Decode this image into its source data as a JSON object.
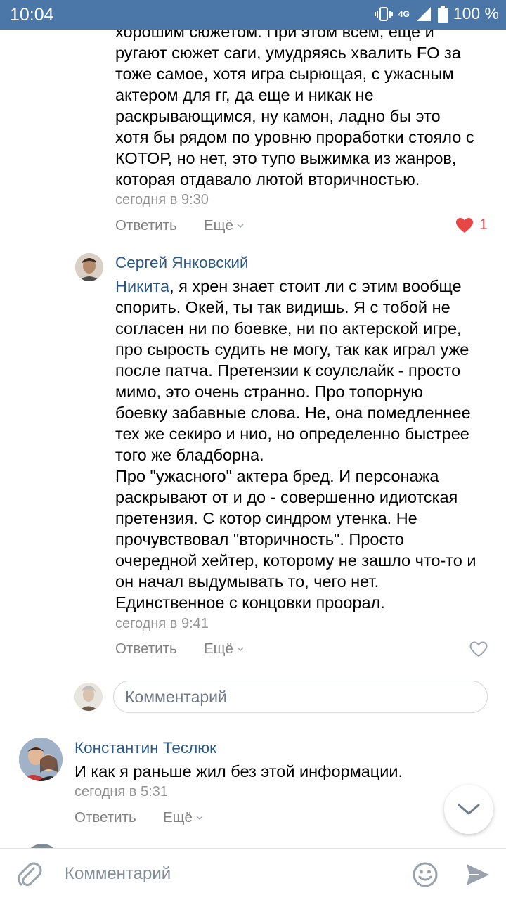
{
  "status_bar": {
    "time": "10:04",
    "network": "4G",
    "battery": "100 %"
  },
  "comment1": {
    "lines": [
      "хорошим сюжетом. При этом всем, еще и",
      "ругают сюжет саги, умудряясь хвалить FO за",
      "тоже самое, хотя игра сырющая, с ужасным",
      "актером для гг, да еще и никак не",
      "раскрывающимся, ну камон, ладно бы это",
      "хотя бы рядом по уровню проработки стояло с",
      "КОТОР, но нет, это тупо выжимка из жанров,",
      "которая отдавало лютой вторичностью."
    ],
    "time": "сегодня в 9:30",
    "reply": "Ответить",
    "more": "Ещё",
    "likes": "1"
  },
  "comment2": {
    "author": "Сергей Янковский",
    "mention": "Никита",
    "first_line_rest": ", я хрен знает стоит ли с этим вообще",
    "lines": [
      "спорить. Окей, ты так видишь. Я с тобой не",
      "согласен ни по боевке, ни по актерской игре,",
      "про сырость судить не могу, так как играл уже",
      "после патча. Претензии к соулслайк - просто",
      "мимо, это очень странно. Про топорную",
      "боевку забавные слова. Не, она помедленнее",
      "тех же секиро и нио, но определенно быстрее",
      "того же бладборна.",
      "Про \"ужасного\" актера бред. И персонажа",
      "раскрывают от и до - совершенно идиотская",
      "претензия. С котор синдром утенка. Не",
      "прочувствовал \"вторичность\". Просто",
      "очередной хейтер, которому не зашло что-то и",
      "он начал выдумывать то, чего нет.",
      "Единственное с концовки проорал."
    ],
    "time": "сегодня в 9:41",
    "reply": "Ответить",
    "more": "Ещё"
  },
  "reply_input": {
    "placeholder": "Комментарий"
  },
  "comment3": {
    "author": "Константин Теслюк",
    "text": "И как я раньше жил без этой информации.",
    "time": "сегодня в 5:31",
    "reply": "Ответить",
    "more": "Ещё"
  },
  "bottom_bar": {
    "placeholder": "Комментарий"
  },
  "icons": {
    "heart_filled": "heart-filled-icon",
    "heart_outline": "heart-outline-icon",
    "attach": "paperclip-icon",
    "emoji": "smile-icon",
    "send": "send-icon",
    "scroll_down": "chevron-down-icon"
  },
  "colors": {
    "header": "#4a76a8",
    "link": "#2a5885",
    "like": "#e64646",
    "meta": "#939393"
  }
}
